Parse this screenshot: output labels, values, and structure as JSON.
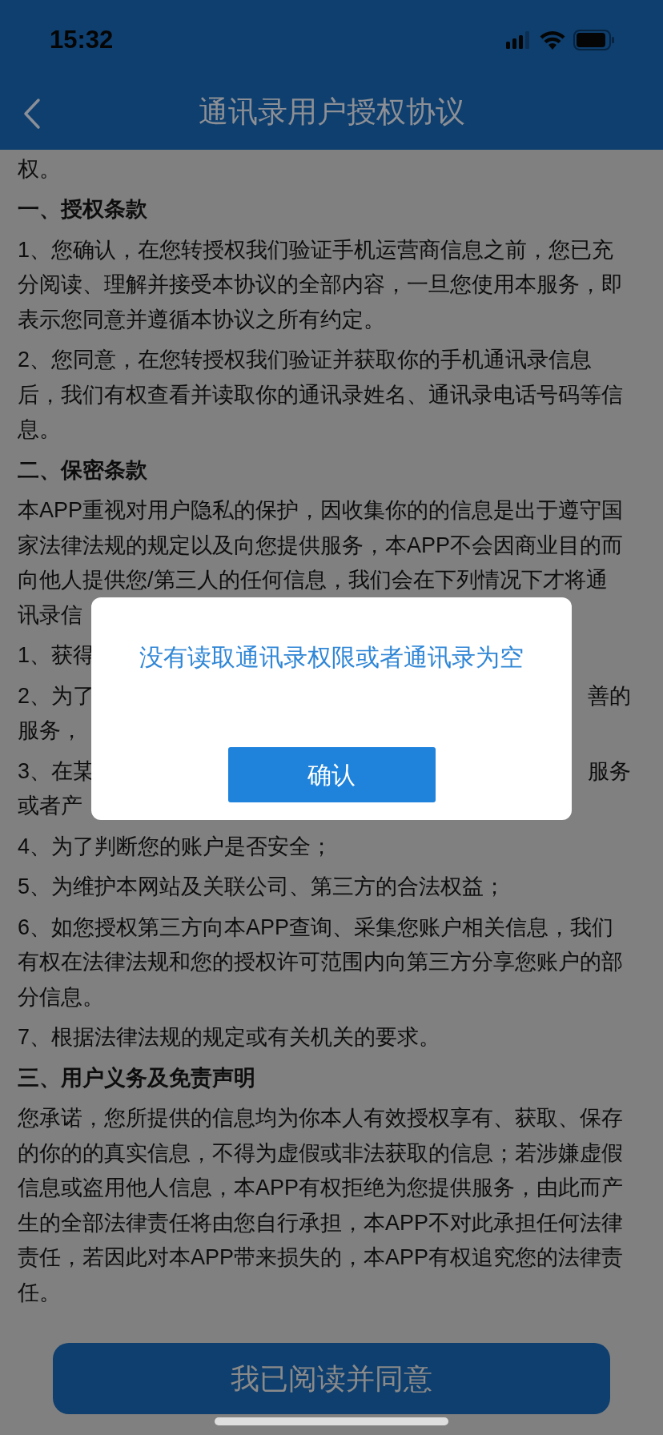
{
  "status_bar": {
    "time": "15:32"
  },
  "nav": {
    "title": "通讯录用户授权协议"
  },
  "content": [
    {
      "kind": "paragraph",
      "lines": [
        {
          "text": "权。"
        }
      ]
    },
    {
      "kind": "heading",
      "lines": [
        {
          "text": "一、授权条款"
        }
      ]
    },
    {
      "kind": "paragraph",
      "lines": [
        {
          "text": "1、您确认，在您转授权我们验证手机运营商信息之前，您已充"
        },
        {
          "text": "分阅读、理解并接受本协议的全部内容，一旦您使用本服务，即"
        },
        {
          "text": "表示您同意并遵循本协议之所有约定。"
        }
      ]
    },
    {
      "kind": "paragraph",
      "lines": [
        {
          "text": "2、您同意，在您转授权我们验证并获取你的手机通讯录信息"
        },
        {
          "text": "后，我们有权查看并读取你的通讯录姓名、通讯录电话号码等信"
        },
        {
          "text": "息。"
        }
      ]
    },
    {
      "kind": "heading",
      "lines": [
        {
          "text": "二、保密条款"
        }
      ]
    },
    {
      "kind": "paragraph",
      "lines": [
        {
          "text": "本APP重视对用户隐私的保护，因收集你的的信息是出于遵守国"
        },
        {
          "text": "家法律法规的规定以及向您提供服务，本APP不会因商业目的而"
        },
        {
          "text": "向他人提供您/第三人的任何信息，我们会在下列情况下才将通"
        },
        {
          "text": "讯录信"
        }
      ]
    },
    {
      "kind": "paragraph",
      "lines": [
        {
          "text": "1、获得"
        }
      ]
    },
    {
      "kind": "paragraph",
      "lines": [
        {
          "text": "2、为了",
          "right_text": "善的"
        },
        {
          "text": "服务，"
        }
      ]
    },
    {
      "kind": "paragraph",
      "lines": [
        {
          "text": "3、在某",
          "right_text": "服务"
        },
        {
          "text": "或者产"
        }
      ]
    },
    {
      "kind": "paragraph",
      "lines": [
        {
          "text": "4、为了判断您的账户是否安全；"
        }
      ]
    },
    {
      "kind": "paragraph",
      "lines": [
        {
          "text": "5、为维护本网站及关联公司、第三方的合法权益；"
        }
      ]
    },
    {
      "kind": "paragraph",
      "lines": [
        {
          "text": "6、如您授权第三方向本APP查询、采集您账户相关信息，我们"
        },
        {
          "text": "有权在法律法规和您的授权许可范围内向第三方分享您账户的部"
        },
        {
          "text": "分信息。"
        }
      ]
    },
    {
      "kind": "paragraph",
      "lines": [
        {
          "text": "7、根据法律法规的规定或有关机关的要求。"
        }
      ]
    },
    {
      "kind": "heading",
      "lines": [
        {
          "text": "三、用户义务及免责声明"
        }
      ]
    },
    {
      "kind": "paragraph",
      "lines": [
        {
          "text": "您承诺，您所提供的信息均为你本人有效授权享有、获取、保存"
        },
        {
          "text": "的你的的真实信息，不得为虚假或非法获取的信息；若涉嫌虚假"
        },
        {
          "text": "信息或盗用他人信息，本APP有权拒绝为您提供服务，由此而产"
        },
        {
          "text": "生的全部法律责任将由您自行承担，本APP不对此承担任何法律"
        },
        {
          "text": "责任，若因此对本APP带来损失的，本APP有权追究您的法律责"
        },
        {
          "text": "任。"
        }
      ]
    }
  ],
  "dialog": {
    "message": "没有读取通讯录权限或者通讯录为空",
    "button": "确认"
  },
  "footer_button": "我已阅读并同意"
}
